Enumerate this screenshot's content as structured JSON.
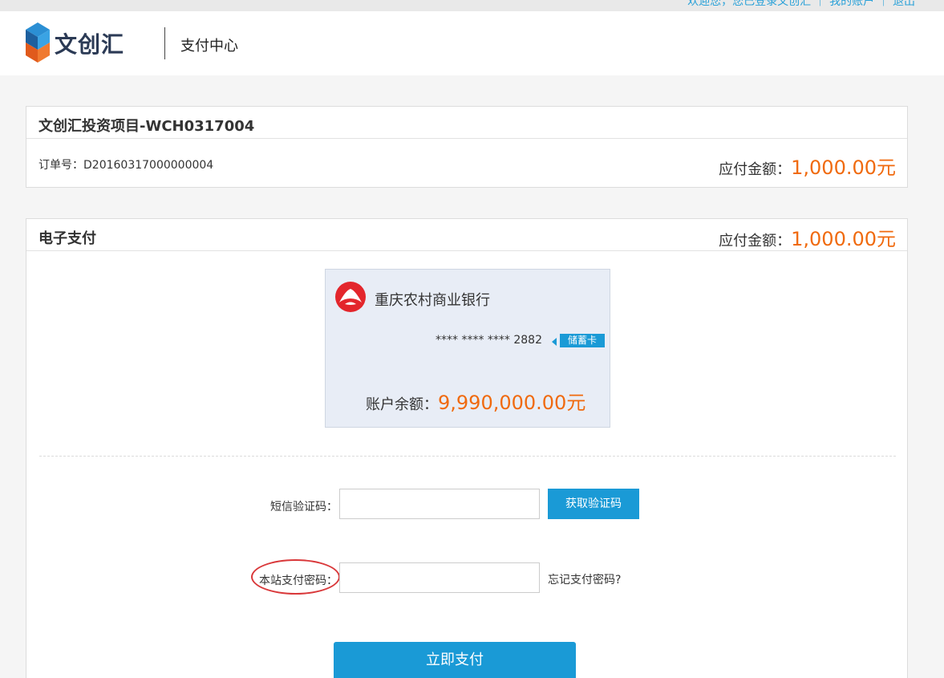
{
  "topbar": {
    "text": "欢迎您，您已登录文创汇 ｜ 我的账户 ｜ 退出"
  },
  "header": {
    "brand_name": "文创汇",
    "page_title": "支付中心",
    "logo_colors": {
      "top": "#2b8fd4",
      "bottom": "#f06a26",
      "side": "#1d5f9e"
    }
  },
  "order": {
    "title": "文创汇投资项目-WCH0317004",
    "order_no_label": "订单号：",
    "order_no": "D20160317000000004",
    "amount_label": "应付金额：",
    "amount_value": "1,000.00元"
  },
  "payment": {
    "title": "电子支付",
    "amount_label": "应付金额：",
    "amount_value": "1,000.00元",
    "card": {
      "bank_icon": "chongqing-rural-bank-logo",
      "bank_name": "重庆农村商业银行",
      "card_number": "**** **** **** 2882",
      "card_type": "储蓄卡",
      "balance_label": "账户余额：",
      "balance_value": "9,990,000.00元"
    },
    "sms": {
      "label": "短信验证码：",
      "value": "",
      "placeholder": "",
      "button_label": "获取验证码"
    },
    "password": {
      "label": "本站支付密码：",
      "value": "",
      "placeholder": "",
      "forgot_label": "忘记支付密码?"
    },
    "submit_label": "立即支付"
  },
  "colors": {
    "accent": "#1a9ad6",
    "amount": "#f06a0e",
    "highlight": "#d9383a"
  }
}
